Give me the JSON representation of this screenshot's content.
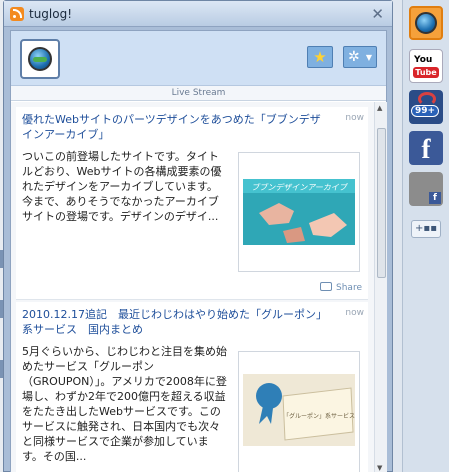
{
  "window": {
    "title": "tuglog!"
  },
  "header": {
    "stream_label": "Live Stream"
  },
  "feed": {
    "items": [
      {
        "title": "優れたWebサイトのパーツデザインをあつめた「ブブンデザインアーカイブ」",
        "time": "now",
        "body": "ついこの前登場したサイトです。タイトルどおり、Webサイトの各構成要素の優れたデザインをアーカイブしています。今まで、ありそうでなかったアーカイブサイトの登場です。デザインのデザイ...",
        "share_label": "Share",
        "thumb_caption": "ブブンデザインアーカイブ"
      },
      {
        "title": "2010.12.17追記　最近じわじわはやり始めた「グルーポン」系サービス　国内まとめ",
        "time": "now",
        "body": "5月ぐらいから、じわじわと注目を集め始めたサービス「グルーポン（GROUPON）」。アメリカで2008年に登場し、わずか2年で200億円を超える収益をたたき出したWebサービスです。このサービスに触発され、日本国内でも次々と同様サービスで企業が参加しています。その国...",
        "thumb_caption": "「グルーポン」系サービス"
      }
    ]
  },
  "rail": {
    "youtube_top": "You",
    "youtube_bottom": "Tube",
    "twitter_badge": "99+",
    "facebook_glyph": "f",
    "facebook_page_glyph": "f",
    "add_label": "+▪▪"
  },
  "colors": {
    "accent": "#f5a13b",
    "link": "#1e4e9a",
    "facebook": "#3b5998"
  }
}
